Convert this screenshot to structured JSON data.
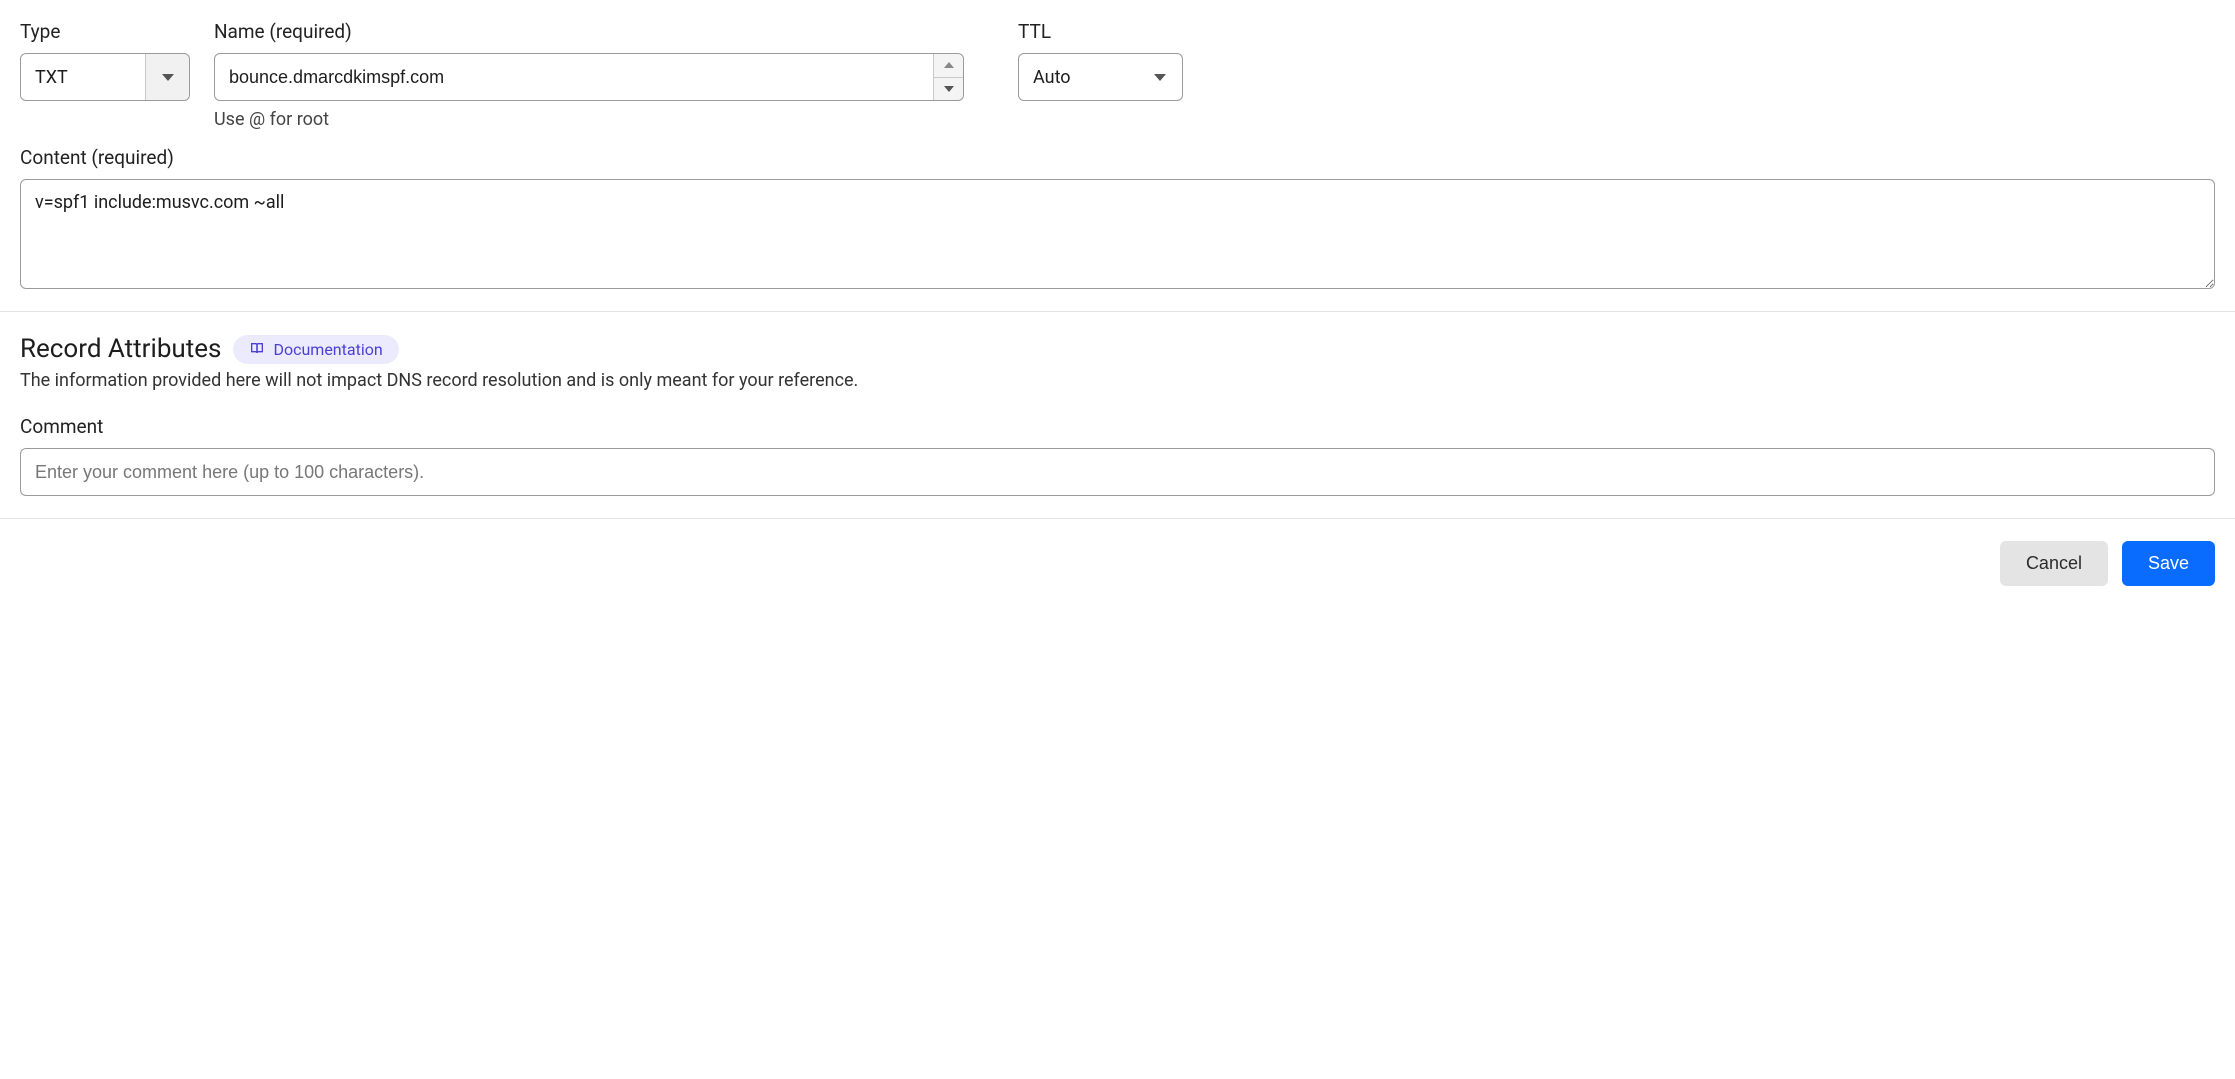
{
  "fields": {
    "type_label": "Type",
    "type_value": "TXT",
    "name_label": "Name (required)",
    "name_value": "bounce.dmarcdkimspf.com",
    "name_hint": "Use @ for root",
    "ttl_label": "TTL",
    "ttl_value": "Auto",
    "content_label": "Content (required)",
    "content_value": "v=spf1 include:musvc.com ~all"
  },
  "attributes": {
    "title": "Record Attributes",
    "doc_label": "Documentation",
    "description": "The information provided here will not impact DNS record resolution and is only meant for your reference.",
    "comment_label": "Comment",
    "comment_placeholder": "Enter your comment here (up to 100 characters)."
  },
  "buttons": {
    "cancel": "Cancel",
    "save": "Save"
  }
}
